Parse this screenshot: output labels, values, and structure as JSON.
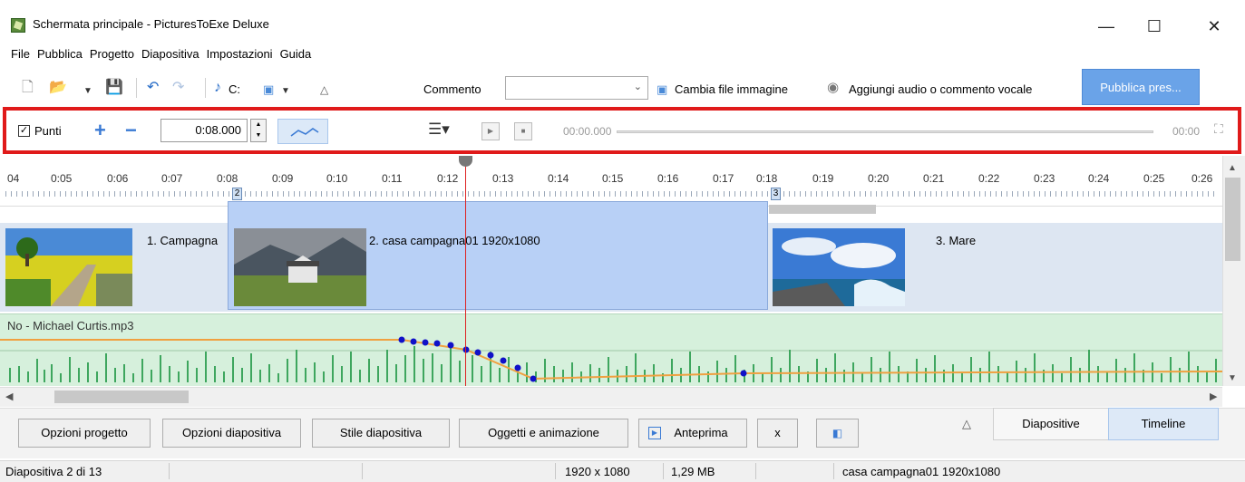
{
  "window": {
    "title": "Schermata principale - PicturesToExe Deluxe",
    "minimize": "—",
    "maximize": "☐",
    "close": "✕"
  },
  "menu": [
    "File",
    "Pubblica",
    "Progetto",
    "Diapositiva",
    "Impostazioni",
    "Guida"
  ],
  "toolbar": {
    "drive_label": "C:",
    "commento_label": "Commento",
    "commento_value": "",
    "change_image": "Cambia file immagine",
    "add_audio": "Aggiungi audio o commento vocale",
    "publish": "Pubblica pres..."
  },
  "keyframe_bar": {
    "checkbox_checked": true,
    "points_label": "Punti",
    "duration_value": "0:08.000",
    "position_time": "00:00.000",
    "end_time": "00:00"
  },
  "ruler": {
    "ticks": [
      "04",
      "0:05",
      "0:06",
      "0:07",
      "0:08",
      "0:09",
      "0:10",
      "0:11",
      "0:12",
      "0:13",
      "0:14",
      "0:15",
      "0:16",
      "0:17",
      "0:18",
      "0:19",
      "0:20",
      "0:21",
      "0:22",
      "0:23",
      "0:24",
      "0:25",
      "0:26"
    ],
    "marker_2": "2",
    "marker_3": "3"
  },
  "slides": [
    {
      "label": "1. Campagna"
    },
    {
      "label": "2. casa campagna01 1920x1080"
    },
    {
      "label": "3. Mare"
    }
  ],
  "audio": {
    "track_label": "No - Michael Curtis.mp3"
  },
  "bottom_buttons": {
    "project_options": "Opzioni progetto",
    "slide_options": "Opzioni diapositiva",
    "slide_style": "Stile diapositiva",
    "objects_animation": "Oggetti e animazione",
    "preview": "Anteprima",
    "x": "x"
  },
  "tabs": {
    "slides": "Diapositive",
    "timeline": "Timeline"
  },
  "status": {
    "slide_pos": "Diapositiva 2 di 13",
    "resolution": "1920 x 1080",
    "size": "1,29 MB",
    "file": "casa campagna01 1920x1080"
  },
  "colors": {
    "accent": "#6aa3e8",
    "highlight_border": "#e01a1a",
    "playhead": "#dd2222",
    "audio_bg": "#d6f0dc"
  }
}
